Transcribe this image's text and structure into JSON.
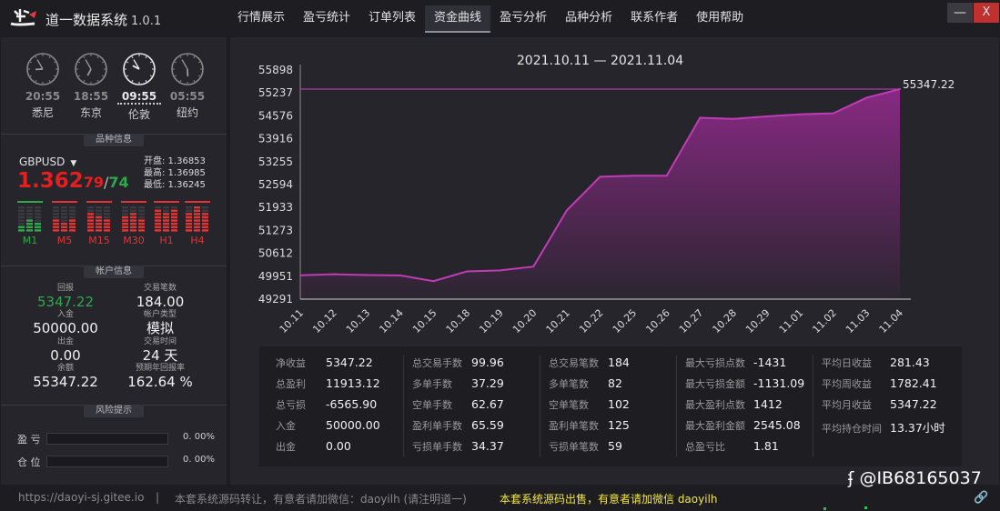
{
  "app": {
    "title": "道一数据系统",
    "version": "1.0.1"
  },
  "nav": {
    "tabs": [
      {
        "label": "行情展示",
        "active": false
      },
      {
        "label": "盈亏统计",
        "active": false
      },
      {
        "label": "订单列表",
        "active": false
      },
      {
        "label": "资金曲线",
        "active": true
      },
      {
        "label": "盈亏分析",
        "active": false
      },
      {
        "label": "品种分析",
        "active": false
      },
      {
        "label": "联系作者",
        "active": false
      },
      {
        "label": "使用帮助",
        "active": false
      }
    ]
  },
  "window": {
    "minimize": "—",
    "close": "X"
  },
  "clocks": [
    {
      "time": "20:55",
      "city": "悉尼",
      "hour": 8,
      "minute": 55,
      "highlight": false
    },
    {
      "time": "18:55",
      "city": "东京",
      "hour": 6,
      "minute": 55,
      "highlight": false
    },
    {
      "time": "09:55",
      "city": "伦敦",
      "hour": 9,
      "minute": 55,
      "highlight": true
    },
    {
      "time": "05:55",
      "city": "纽约",
      "hour": 5,
      "minute": 55,
      "highlight": false
    }
  ],
  "symbol_panel": {
    "header": "品种信息",
    "symbol": "GBPUSD",
    "dropdown": "▼",
    "price_big": "1.362",
    "bid_small": "79",
    "slash": "/",
    "ask_small": "74",
    "open": "开盘: 1.36853",
    "high": "最高: 1.36985",
    "low": "最低: 1.36245",
    "timeframes": [
      {
        "label": "M1",
        "color": "#2ea84b"
      },
      {
        "label": "M5",
        "color": "#e03535"
      },
      {
        "label": "M15",
        "color": "#e03535"
      },
      {
        "label": "M30",
        "color": "#e03535"
      },
      {
        "label": "H1",
        "color": "#e03535"
      },
      {
        "label": "H4",
        "color": "#e03535"
      }
    ]
  },
  "account": {
    "header": "帐户信息",
    "profit_label": "回报",
    "profit_value": "5347.22",
    "profit_color": "#2ea84b",
    "trades_label": "交易笔数",
    "trades_value": "184.00",
    "deposit_label": "入金",
    "deposit_value": "50000.00",
    "type_label": "帐户类型",
    "type_value": "模拟",
    "withdraw_label": "出金",
    "withdraw_value": "0.00",
    "time_label": "交易时间",
    "time_value": "24 天",
    "balance_label": "余额",
    "balance_value": "55347.22",
    "annual_label": "预期年回报率",
    "annual_value": "162.64 %"
  },
  "risk": {
    "header": "风险提示",
    "rows": [
      {
        "label": "盈 亏",
        "pct": "0. 00%"
      },
      {
        "label": "仓 位",
        "pct": "0. 00%"
      }
    ]
  },
  "chart_data": {
    "type": "area",
    "title": "2021.10.11 — 2021.11.04",
    "x": [
      "10.11",
      "10.12",
      "10.13",
      "10.14",
      "10.15",
      "10.18",
      "10.19",
      "10.20",
      "10.21",
      "10.22",
      "10.25",
      "10.26",
      "10.27",
      "10.28",
      "10.29",
      "11.01",
      "11.02",
      "11.03",
      "11.04"
    ],
    "y": [
      49980,
      50010,
      49985,
      49975,
      49810,
      50090,
      50120,
      50230,
      51850,
      52820,
      52850,
      52850,
      54520,
      54490,
      54560,
      54620,
      54650,
      55100,
      55347.22
    ],
    "yticks": [
      49291,
      49951,
      50612,
      51273,
      51933,
      52594,
      53255,
      53916,
      54576,
      55237,
      55898
    ],
    "ylim": [
      49291,
      55898
    ],
    "last_value_label": "55347.22",
    "colors": {
      "line": "#c03cb6",
      "fill_top": "#9a2a93",
      "ref_line": "#b03aa8"
    }
  },
  "stats": [
    [
      {
        "k": "净收益",
        "v": "5347.22"
      },
      {
        "k": "总盈利",
        "v": "11913.12"
      },
      {
        "k": "总亏损",
        "v": "-6565.90"
      },
      {
        "k": "入金",
        "v": "50000.00"
      },
      {
        "k": "出金",
        "v": "0.00"
      }
    ],
    [
      {
        "k": "总交易手数",
        "v": "99.96"
      },
      {
        "k": "多单手数",
        "v": "37.29"
      },
      {
        "k": "空单手数",
        "v": "62.67"
      },
      {
        "k": "盈利单手数",
        "v": "65.59"
      },
      {
        "k": "亏损单手数",
        "v": "34.37"
      }
    ],
    [
      {
        "k": "总交易笔数",
        "v": "184"
      },
      {
        "k": "多单笔数",
        "v": "82"
      },
      {
        "k": "空单笔数",
        "v": "102"
      },
      {
        "k": "盈利单笔数",
        "v": "125"
      },
      {
        "k": "亏损单笔数",
        "v": "59"
      }
    ],
    [
      {
        "k": "最大亏损点数",
        "v": "-1431"
      },
      {
        "k": "最大亏损金额",
        "v": "-1131.09"
      },
      {
        "k": "最大盈利点数",
        "v": "1412"
      },
      {
        "k": "最大盈利金额",
        "v": "2545.08"
      },
      {
        "k": "总盈亏比",
        "v": "1.81"
      }
    ],
    [
      {
        "k": "平均日收益",
        "v": "281.43"
      },
      {
        "k": "平均周收益",
        "v": "1782.41"
      },
      {
        "k": "平均月收益",
        "v": "5347.22"
      },
      {
        "k": "平均持仓时间",
        "v": "13.37小时"
      }
    ]
  ],
  "status": {
    "url": "https://daoyi-sj.gitee.io",
    "pipe": "|",
    "note1": "本套系统源码转让，有意者请加微信：daoyilh (请注明道一)",
    "note2": "本套系统源码出售，有意者请加微信 daoyilh",
    "watermark": "@IB68165037"
  }
}
